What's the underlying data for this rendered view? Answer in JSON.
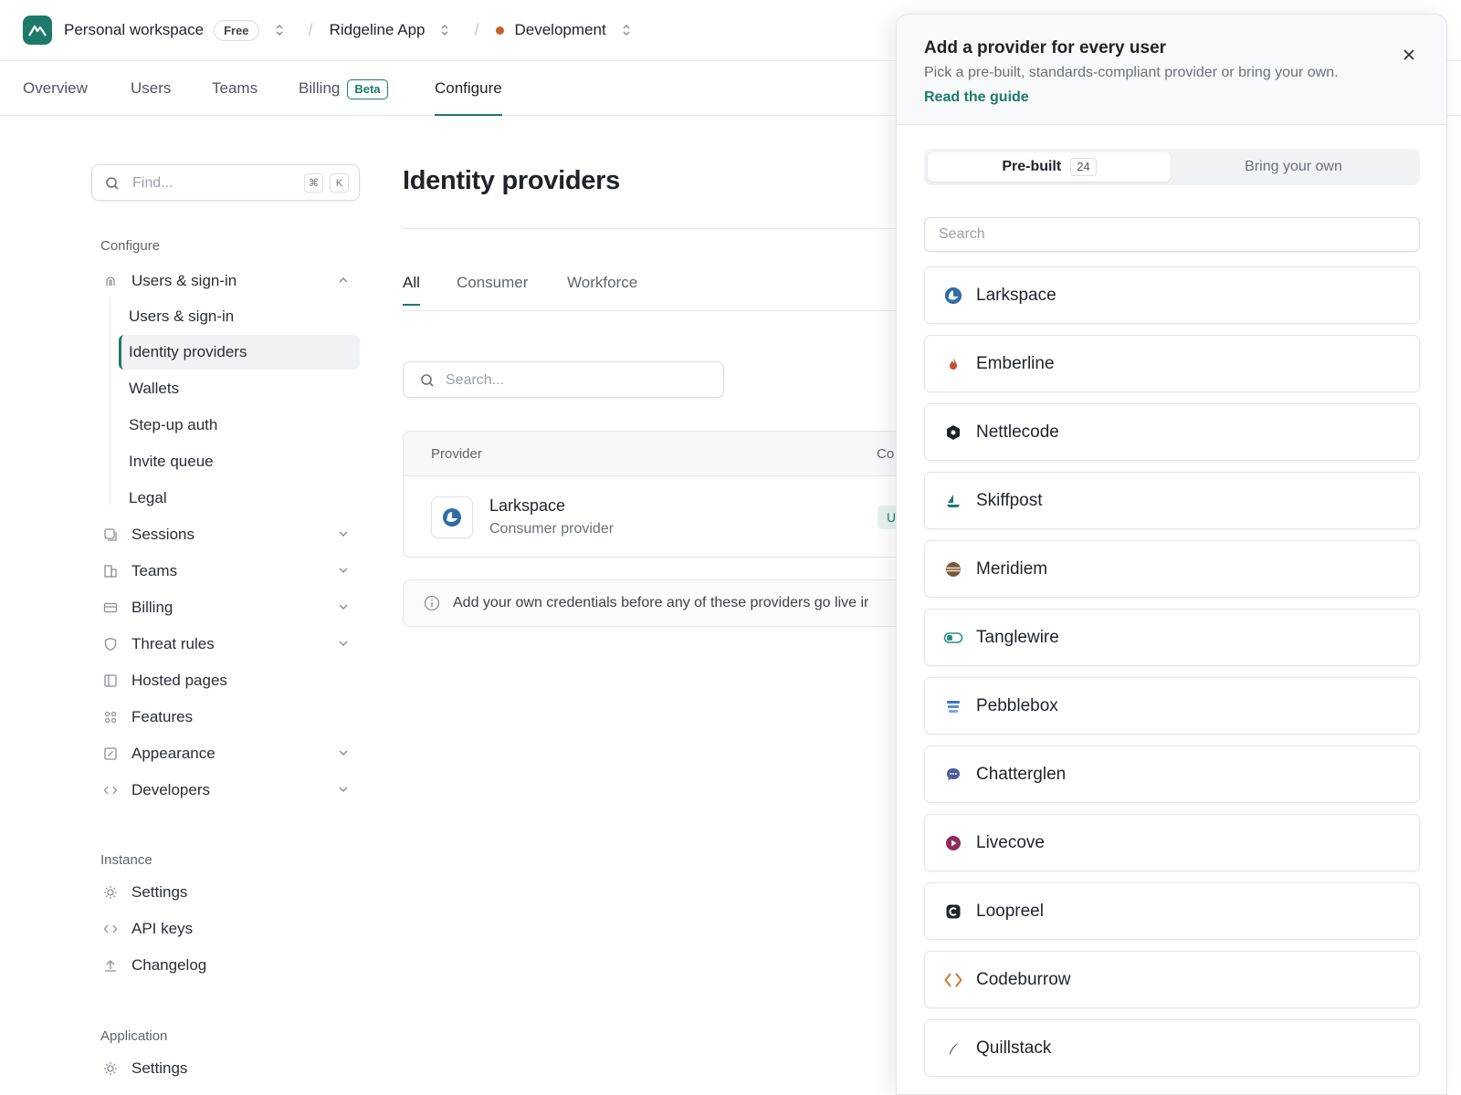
{
  "topbar": {
    "workspace": "Personal workspace",
    "plan": "Free",
    "app": "Ridgeline App",
    "environment": "Development",
    "env_color": "#c4622d"
  },
  "tabs": [
    {
      "label": "Overview"
    },
    {
      "label": "Users"
    },
    {
      "label": "Teams"
    },
    {
      "label": "Billing",
      "badge": "Beta"
    },
    {
      "label": "Configure",
      "active": true
    }
  ],
  "sidebar": {
    "find_placeholder": "Find...",
    "shortcut": [
      "⌘",
      "K"
    ],
    "configure_heading": "Configure",
    "users_signin": "Users & sign-in",
    "sub_items": [
      "Users & sign-in",
      "Identity providers",
      "Wallets",
      "Step-up auth",
      "Invite queue",
      "Legal"
    ],
    "items": [
      "Sessions",
      "Teams",
      "Billing",
      "Threat rules",
      "Hosted pages",
      "Features",
      "Appearance",
      "Developers"
    ],
    "instance_heading": "Instance",
    "instance_items": [
      "Settings",
      "API keys",
      "Changelog"
    ],
    "application_heading": "Application",
    "application_items": [
      "Settings"
    ]
  },
  "main": {
    "title": "Identity providers",
    "filters": [
      "All",
      "Consumer",
      "Workforce"
    ],
    "search_placeholder": "Search...",
    "table": {
      "col_provider": "Provider",
      "col_second": "Co",
      "row": {
        "name": "Larkspace",
        "type": "Consumer provider",
        "status": "U"
      }
    },
    "note": "Add your own credentials before any of these providers go live ir"
  },
  "panel": {
    "title": "Add a provider for every user",
    "description": "Pick a pre-built, standards-compliant provider or bring your own.",
    "guide": "Read the guide",
    "seg_prebuilt": "Pre-built",
    "seg_count": "24",
    "seg_byo": "Bring your own",
    "search_placeholder": "Search",
    "providers": [
      {
        "name": "Larkspace",
        "icon": "larkspace-icon",
        "color": "#2e6da4"
      },
      {
        "name": "Emberline",
        "icon": "flame-icon",
        "color": "#c4522d"
      },
      {
        "name": "Nettlecode",
        "icon": "hexagon-icon",
        "color": "#1f2329"
      },
      {
        "name": "Skiffpost",
        "icon": "sailboat-icon",
        "color": "#1d7a6a"
      },
      {
        "name": "Meridiem",
        "icon": "striped-circle-icon",
        "color": "#7a5a3a"
      },
      {
        "name": "Tanglewire",
        "icon": "toggle-icon",
        "color": "#2e8c8c"
      },
      {
        "name": "Pebblebox",
        "icon": "stack-icon",
        "color": "#3f72c4"
      },
      {
        "name": "Chatterglen",
        "icon": "chat-bubble-icon",
        "color": "#4a5a9a"
      },
      {
        "name": "Livecove",
        "icon": "play-circle-icon",
        "color": "#8b2c5c"
      },
      {
        "name": "Loopreel",
        "icon": "loop-icon",
        "color": "#1f2329"
      },
      {
        "name": "Codeburrow",
        "icon": "code-brackets-icon",
        "color": "#d07a3a"
      },
      {
        "name": "Quillstack",
        "icon": "quill-icon",
        "color": "#4a5a8a"
      }
    ]
  }
}
